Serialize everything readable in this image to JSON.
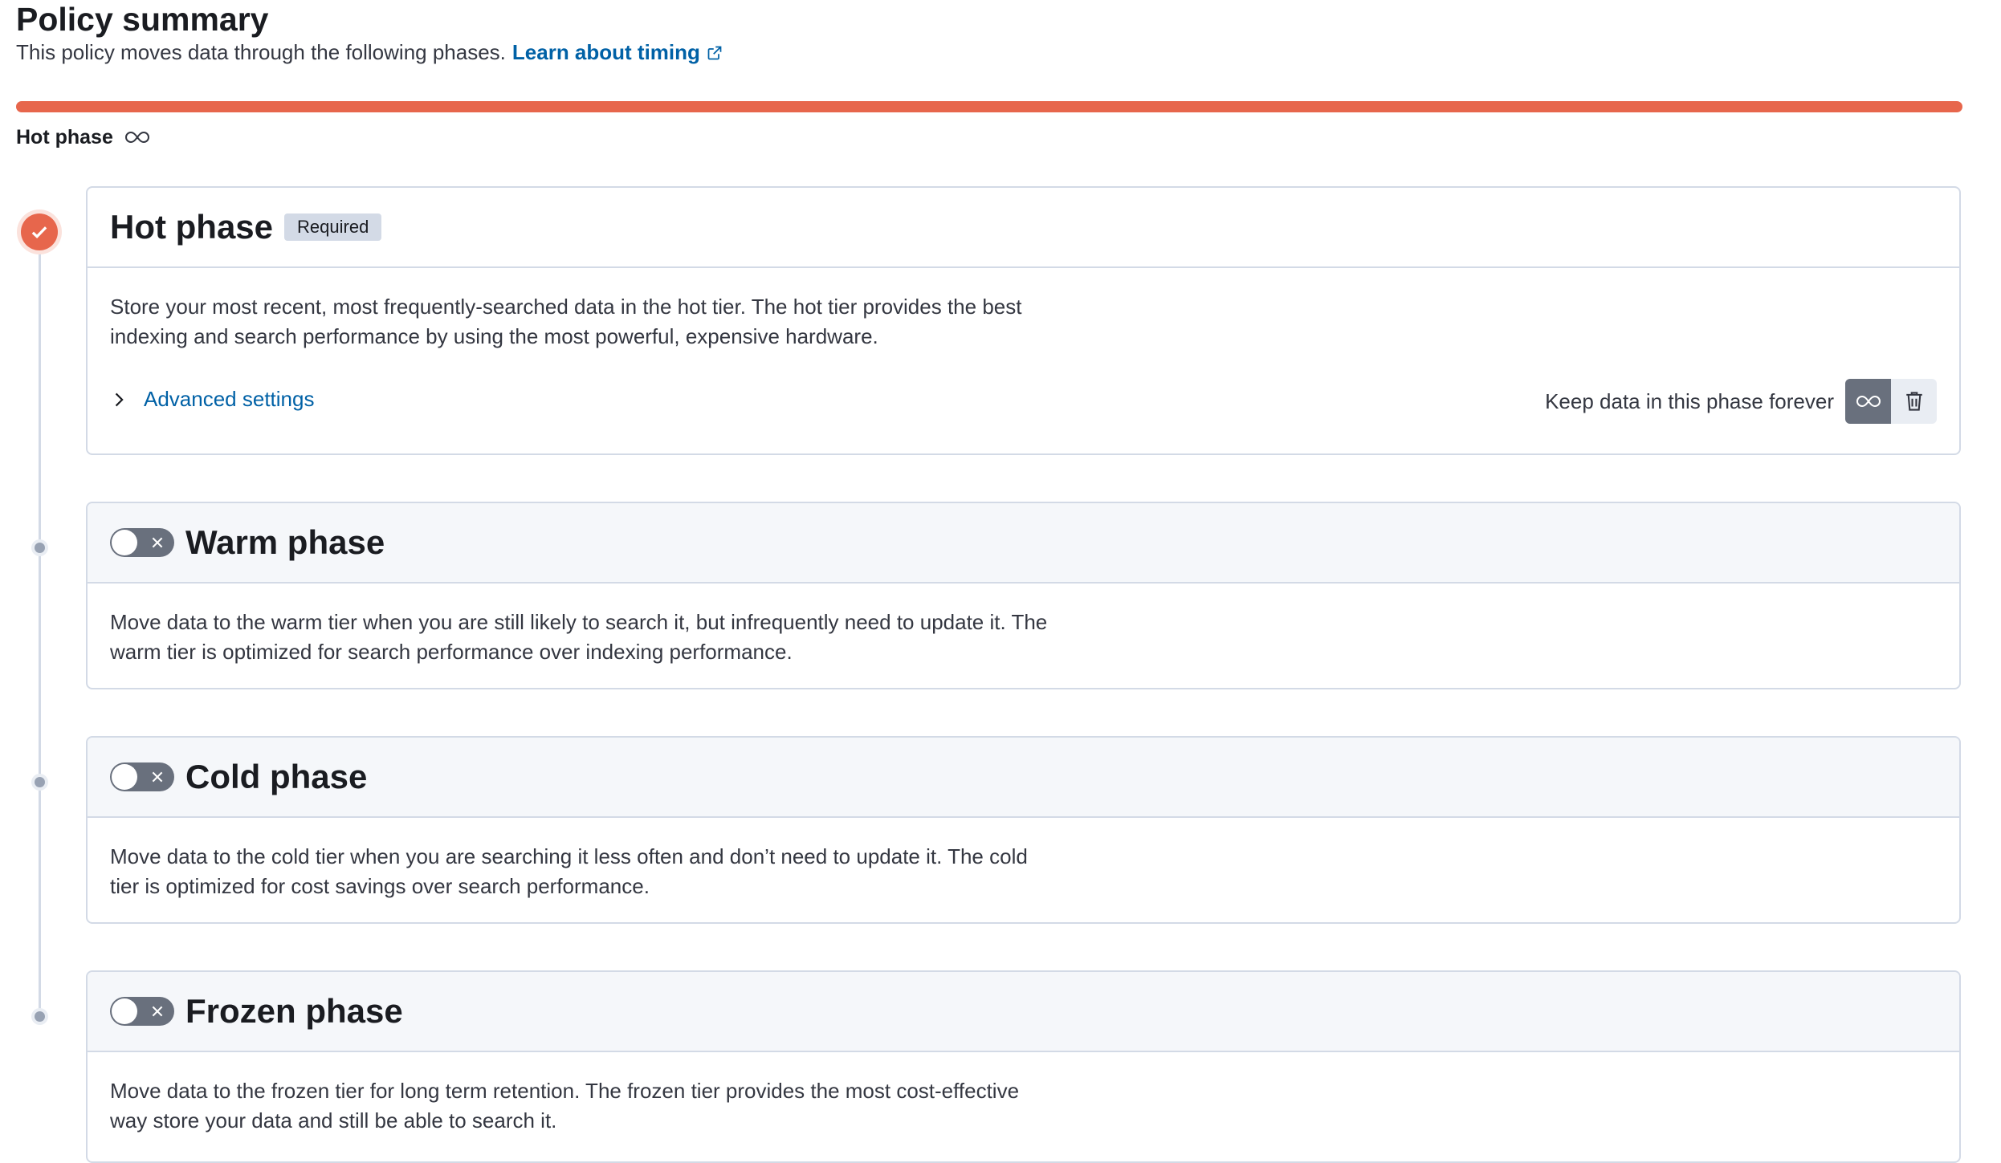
{
  "header": {
    "title": "Policy summary",
    "subtitle": "This policy moves data through the following phases.",
    "learn_link": "Learn about timing"
  },
  "summary": {
    "bar_color": "#e7664c",
    "phase_label": "Hot phase",
    "phase_icon": "infinity-icon"
  },
  "phases": {
    "hot": {
      "title": "Hot phase",
      "badge": "Required",
      "description": "Store your most recent, most frequently-searched data in the hot tier. The hot tier provides the best indexing and search performance by using the most powerful, expensive hardware.",
      "advanced_label": "Advanced settings",
      "keep_label": "Keep data in this phase forever",
      "status_icon": "check-icon",
      "accent": "#e7664c"
    },
    "warm": {
      "title": "Warm phase",
      "enabled": false,
      "description": "Move data to the warm tier when you are still likely to search it, but infrequently need to update it. The warm tier is optimized for search performance over indexing performance."
    },
    "cold": {
      "title": "Cold phase",
      "enabled": false,
      "description": "Move data to the cold tier when you are searching it less often and don’t need to update it. The cold tier is optimized for cost savings over search performance."
    },
    "frozen": {
      "title": "Frozen phase",
      "enabled": false,
      "description": "Move data to the frozen tier for long term retention. The frozen tier provides the most cost-effective way store your data and still be able to search it."
    }
  }
}
